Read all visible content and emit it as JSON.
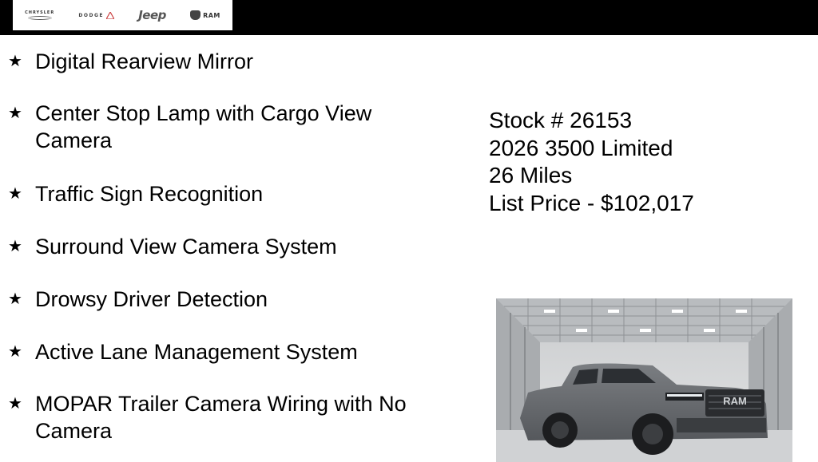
{
  "header": {
    "brands": [
      "CHRYSLER",
      "DODGE",
      "Jeep",
      "RAM"
    ]
  },
  "features": [
    {
      "star": "★",
      "text": "Digital Rearview Mirror"
    },
    {
      "star": "★",
      "text": "Center Stop Lamp with Cargo View Camera"
    },
    {
      "star": "★",
      "text": "Traffic Sign Recognition"
    },
    {
      "star": "★",
      "text": "Surround View Camera System"
    },
    {
      "star": "★",
      "text": "Drowsy Driver Detection"
    },
    {
      "star": "★",
      "text": "Active Lane Management System"
    },
    {
      "star": "★",
      "text": "MOPAR Trailer Camera Wiring with No Camera"
    }
  ],
  "vehicle": {
    "stock": "Stock # 26153",
    "model": "2026 3500 Limited",
    "miles": "26 Miles",
    "price": "List Price - $102,017"
  },
  "photo": {
    "grille_badge": "RAM",
    "truck_color": "#6b6e72"
  }
}
